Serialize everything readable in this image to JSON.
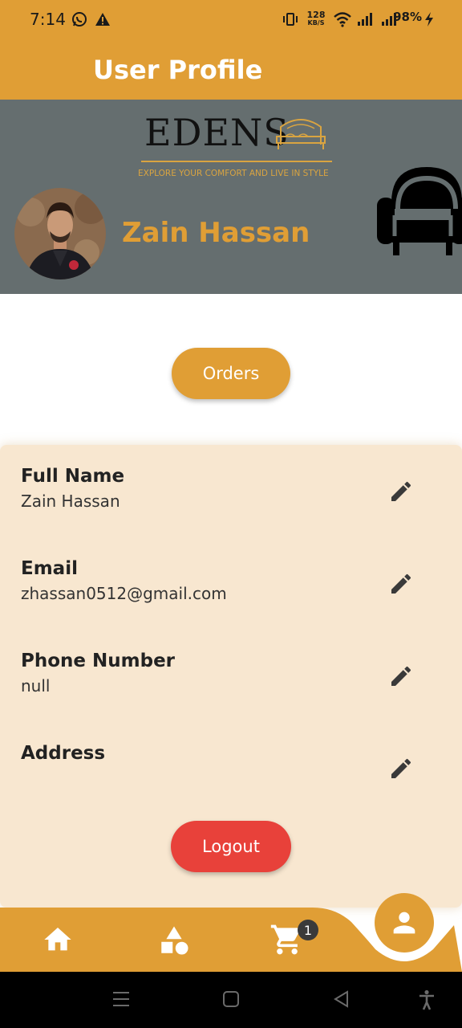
{
  "status_bar": {
    "time": "7:14",
    "net_speed_value": "128",
    "net_speed_unit": "KB/S",
    "battery": "98%"
  },
  "app_bar": {
    "title": "User Profile"
  },
  "header": {
    "logo_text": "EDENS",
    "logo_tagline": "EXPLORE YOUR COMFORT AND LIVE IN STYLE",
    "user_name": "Zain Hassan"
  },
  "actions": {
    "orders_label": "Orders",
    "logout_label": "Logout"
  },
  "fields": [
    {
      "label": "Full Name",
      "value": "Zain Hassan"
    },
    {
      "label": "Email",
      "value": "zhassan0512@gmail.com"
    },
    {
      "label": "Phone Number",
      "value": "null"
    },
    {
      "label": "Address",
      "value": ""
    }
  ],
  "bottom_nav": {
    "items": [
      "home-icon",
      "categories-icon",
      "cart-icon",
      "profile-icon"
    ],
    "cart_count": "1",
    "active": "profile"
  },
  "colors": {
    "accent": "#e09e35",
    "header_bg": "#656e6f",
    "card_bg": "#f8e7d0",
    "logout": "#e8413a"
  }
}
